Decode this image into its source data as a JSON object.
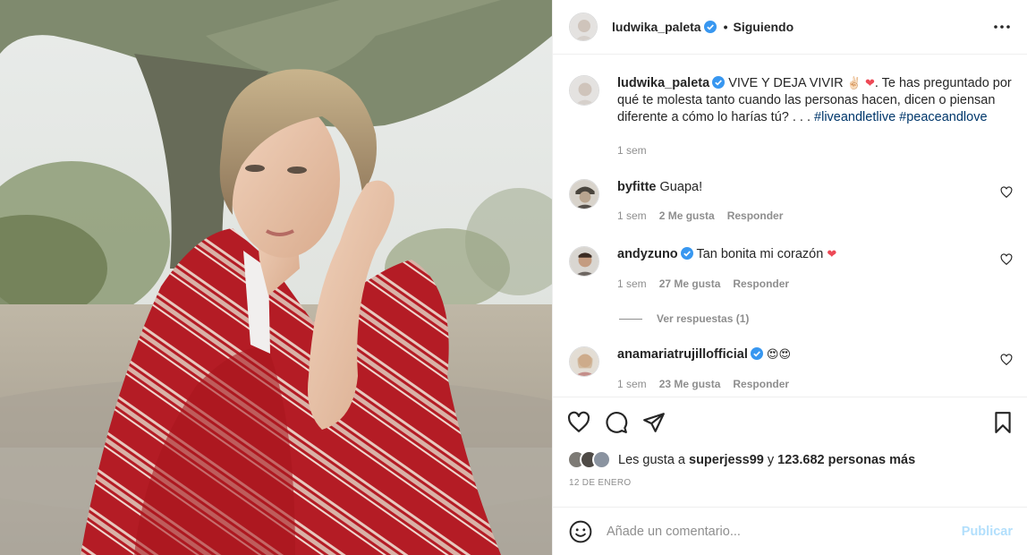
{
  "post": {
    "username": "ludwika_paleta",
    "follow_status": "Siguiendo",
    "separator": "•",
    "caption": {
      "text_main": "VIVE Y DEJA VIVIR",
      "emojis": "✌🏻 ❤",
      "text_rest": ". Te has preguntado por qué te molesta tanto cuando las personas hacen, dicen o piensan diferente a cómo lo harías tú? . . .",
      "hashtags": [
        "#liveandletlive",
        "#peaceandlove"
      ],
      "time": "1 sem"
    }
  },
  "comments": [
    {
      "username": "byfitte",
      "verified": false,
      "text": "Guapa!",
      "time": "1 sem",
      "likes": "2 Me gusta",
      "reply": "Responder"
    },
    {
      "username": "andyzuno",
      "verified": true,
      "text": "Tan bonita mi corazón",
      "emoji": "❤",
      "time": "1 sem",
      "likes": "27 Me gusta",
      "reply": "Responder",
      "view_replies": "Ver respuestas (1)"
    },
    {
      "username": "anamariatrujillofficial",
      "verified": true,
      "text": "",
      "emoji": "😍😍",
      "time": "1 sem",
      "likes": "23 Me gusta",
      "reply": "Responder"
    }
  ],
  "likes": {
    "prefix": "Les gusta a",
    "user": "superjess99",
    "conj": "y",
    "count": "123.682 personas más"
  },
  "date": "12 DE ENERO",
  "add_comment": {
    "placeholder": "Añade un comentario...",
    "publish": "Publicar"
  },
  "colors": {
    "verified": "#3897f0",
    "link": "#00376b",
    "muted": "#8e8e8e",
    "publish_disabled": "#b2dffc",
    "heart": "#ed4956"
  },
  "icons": [
    "more-icon",
    "heart-icon",
    "comment-icon",
    "share-icon",
    "bookmark-icon",
    "emoji-icon",
    "verified-icon"
  ]
}
